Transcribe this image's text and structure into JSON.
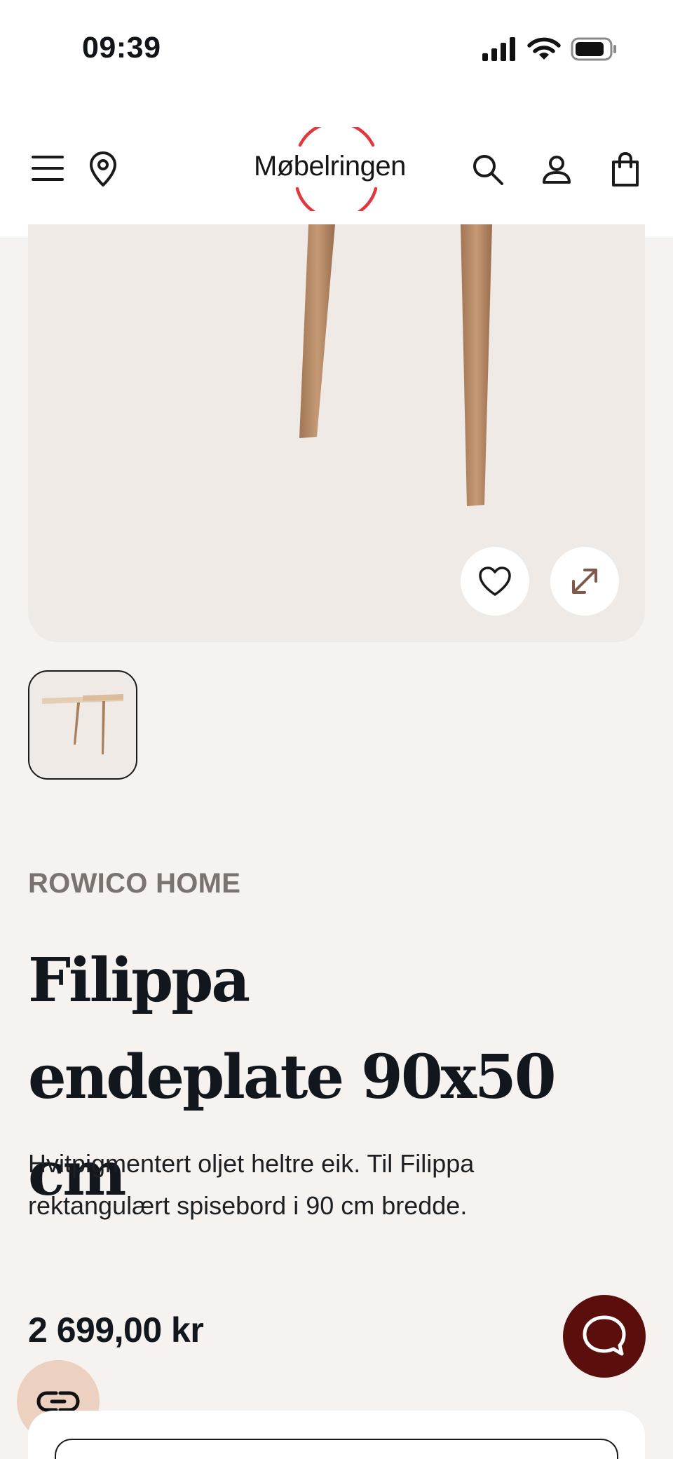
{
  "status_bar": {
    "time": "09:39",
    "icons": [
      "signal-icon",
      "wifi-icon",
      "battery-icon"
    ]
  },
  "header": {
    "logo_text": "Møbelringen",
    "icons": [
      "menu-icon",
      "location-pin-icon",
      "search-icon",
      "user-icon",
      "shopping-bag-icon"
    ],
    "brand_color": "#e0383e"
  },
  "product": {
    "brand": "ROWICO HOME",
    "title": "Filippa endeplate 90x50 cm",
    "description": "Hvitpigmentert oljet heltre eik. Til Filippa rektangulært spisebord i 90 cm bredde.",
    "price": "2 699,00 kr"
  },
  "image_actions": [
    "heart-icon",
    "expand-icon"
  ],
  "floating": {
    "chat_color": "#5a0f0c",
    "compare_color": "#ecd0c0"
  }
}
